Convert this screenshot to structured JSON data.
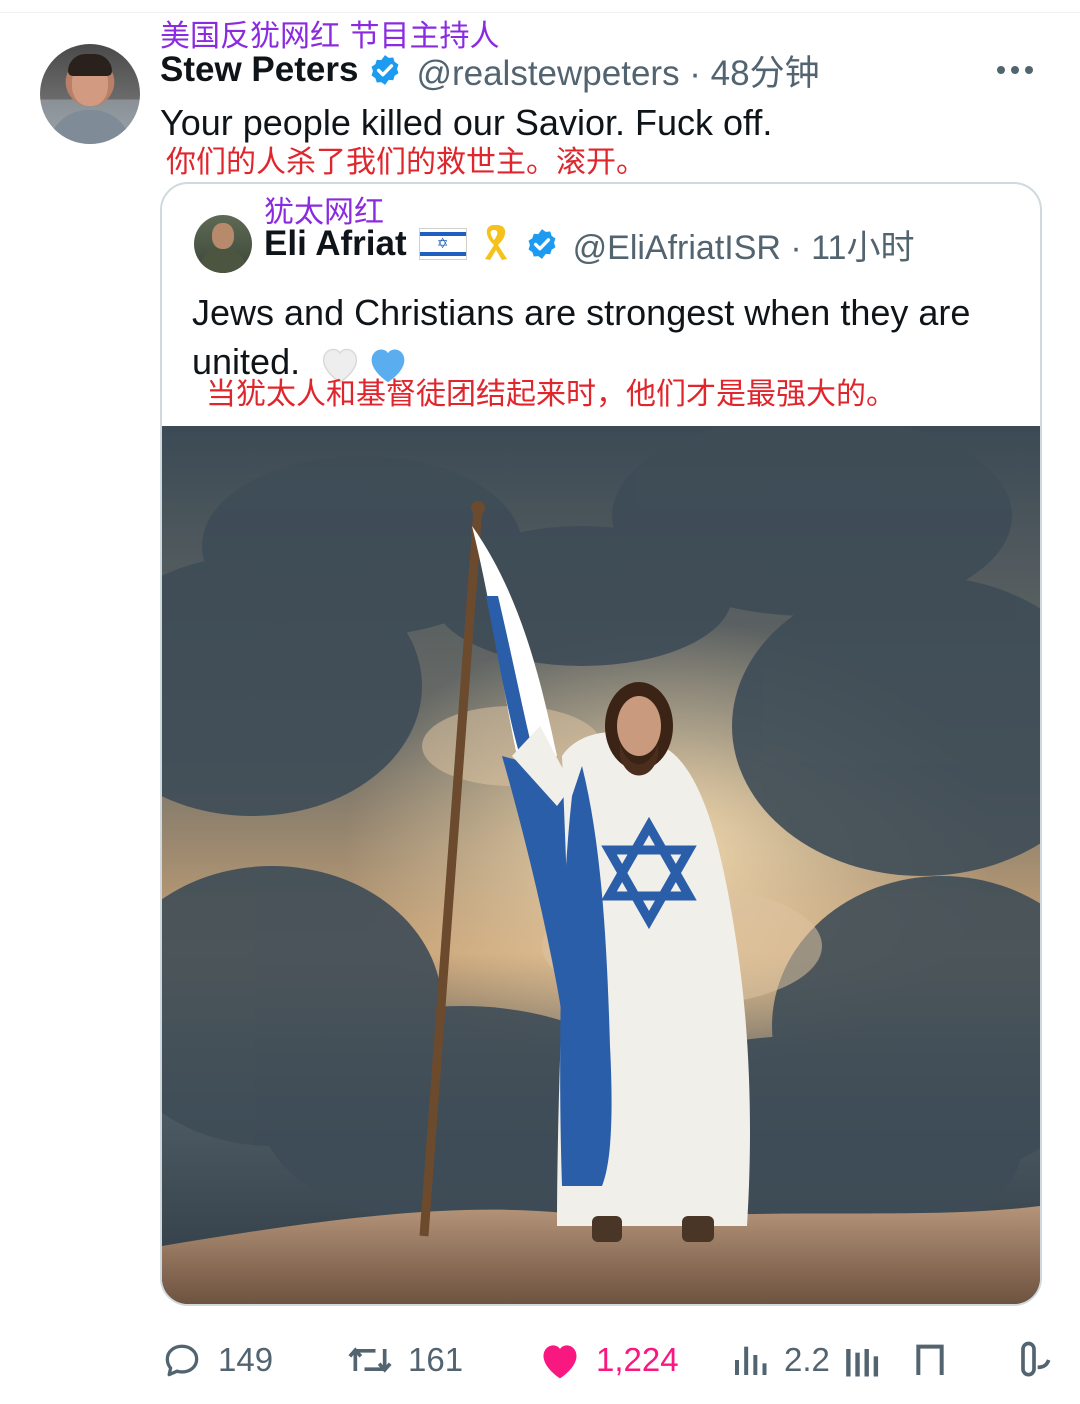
{
  "annotations": {
    "main_author_note": "美国反犹网红 节目主持人",
    "main_text_translation": "你们的人杀了我们的救世主。滚开。",
    "quote_author_note": "犹太网红",
    "quote_text_translation": "当犹太人和基督徒团结起来时，他们才是最强大的。"
  },
  "main_tweet": {
    "author_name": "Stew Peters",
    "handle_time": "@realstewpeters · 48分钟",
    "text": "Your people killed our Savior. Fuck off."
  },
  "quoted_tweet": {
    "author_name": "Eli Afriat",
    "handle_time": "@EliAfriatISR · 11小时",
    "text": "Jews and Christians are strongest when they are united."
  },
  "actions": {
    "replies": "149",
    "retweets": "161",
    "likes": "1,224",
    "views": "2.2"
  },
  "colors": {
    "verified": "#1d9bf0",
    "like_active": "#f91880",
    "muted": "#536471",
    "annotation_purple": "#8b2be0",
    "annotation_red": "#e0262d"
  },
  "icons": [
    "verified-badge-icon",
    "more-icon",
    "israel-flag-icon",
    "yellow-ribbon-icon",
    "white-heart-icon",
    "blue-heart-icon",
    "reply-icon",
    "retweet-icon",
    "like-icon",
    "views-icon",
    "bookmark-icon",
    "share-icon"
  ]
}
